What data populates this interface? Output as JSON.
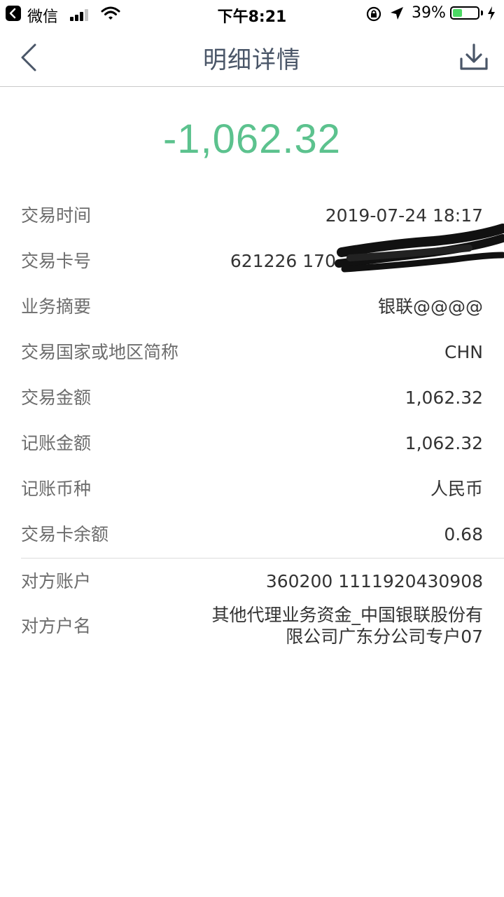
{
  "status_bar": {
    "back_app": "微信",
    "time": "下午8:21",
    "battery": "39%",
    "battery_level": 0.39
  },
  "nav": {
    "title": "明细详情"
  },
  "amount": "-1,062.32",
  "accent_color": "#5cc28e",
  "details": [
    {
      "label": "交易时间",
      "value": "2019-07-24 18:17"
    },
    {
      "label": "交易卡号",
      "value": "621226 170"
    },
    {
      "label": "业务摘要",
      "value": "银联@@@@"
    },
    {
      "label": "交易国家或地区简称",
      "value": "CHN"
    },
    {
      "label": "交易金额",
      "value": "1,062.32"
    },
    {
      "label": "记账金额",
      "value": "1,062.32"
    },
    {
      "label": "记账币种",
      "value": "人民币"
    },
    {
      "label": "交易卡余额",
      "value": "0.68"
    }
  ],
  "counterparty": [
    {
      "label": "对方账户",
      "value": "360200 1111920430908"
    },
    {
      "label": "对方户名",
      "value": "其他代理业务资金_中国银联股份有限公司广东分公司专户07"
    }
  ]
}
